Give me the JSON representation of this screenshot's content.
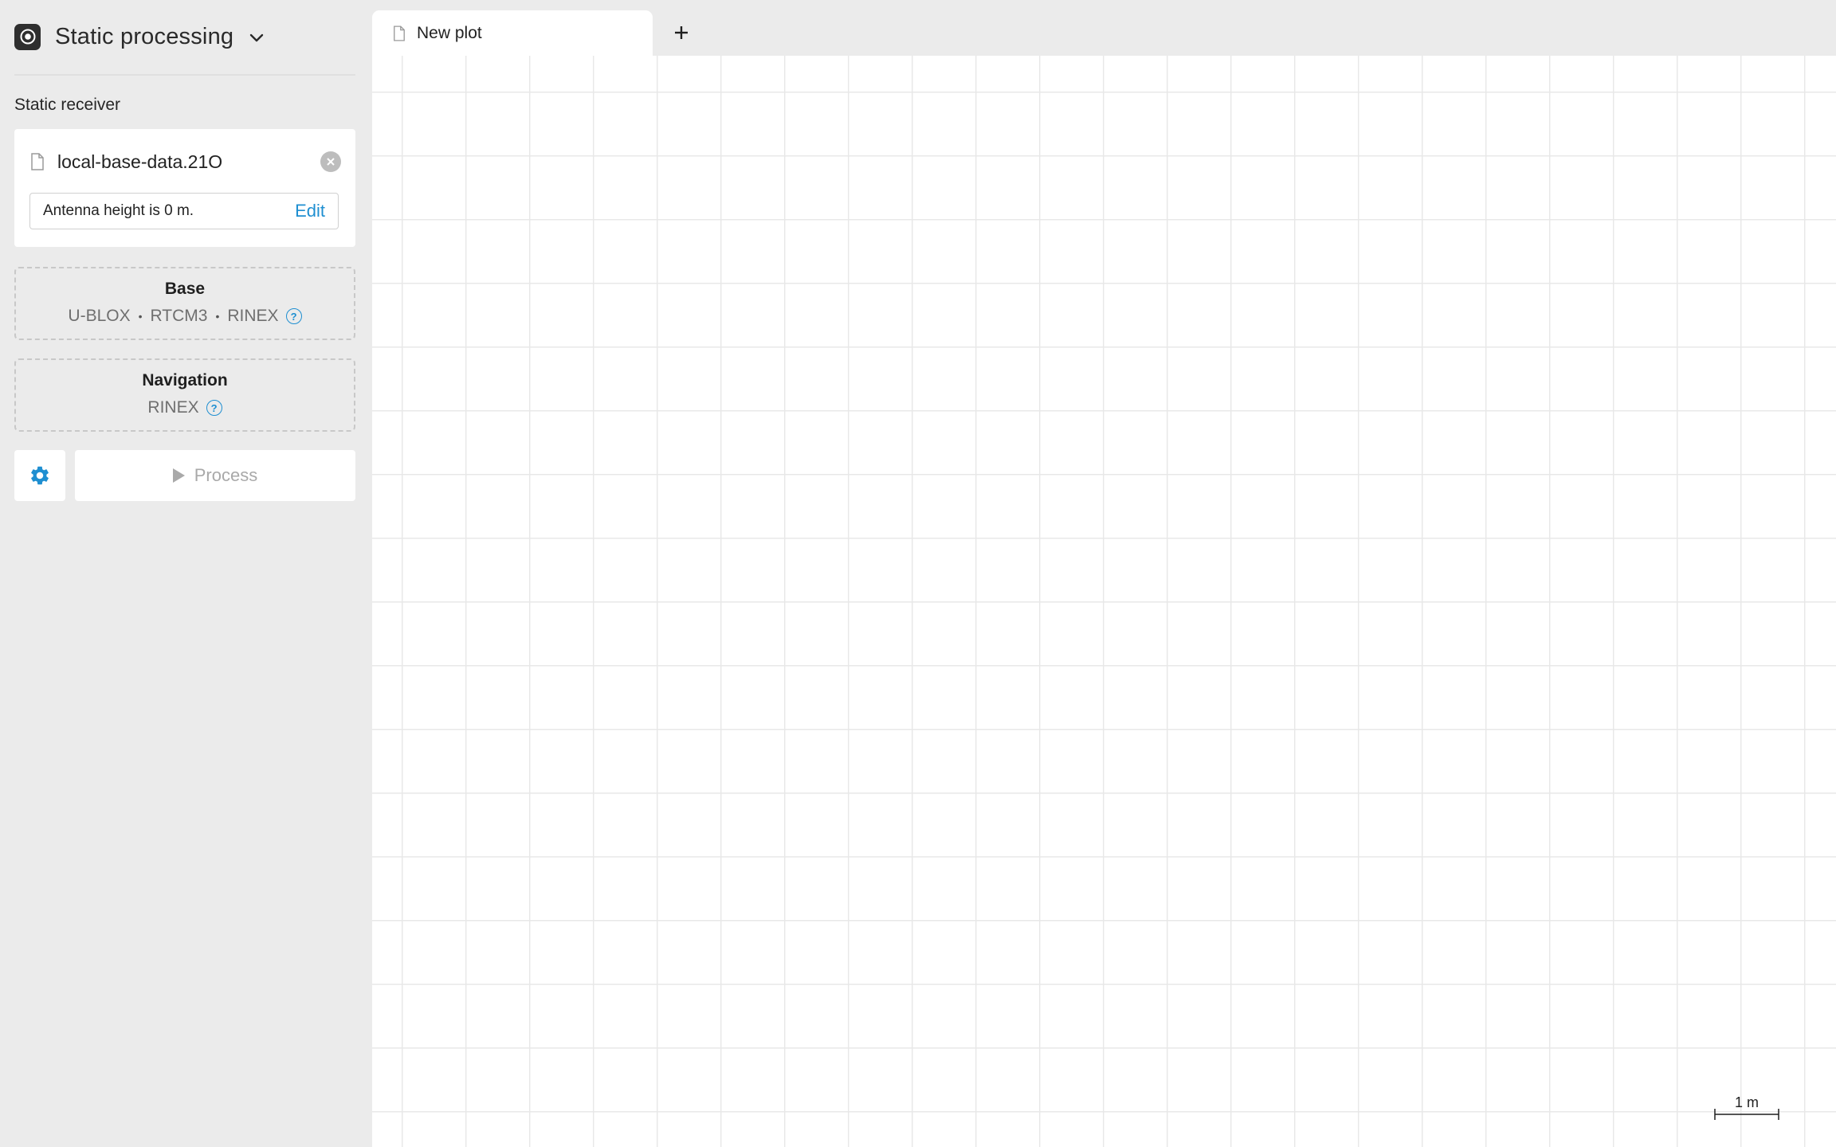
{
  "header": {
    "title": "Static processing",
    "logo_icon": "target-icon",
    "dropdown_icon": "chevron-down-icon"
  },
  "sidebar": {
    "section_label": "Static receiver",
    "file": {
      "name": "local-base-data.21O",
      "icon": "file-icon",
      "clear_icon": "close-circle-icon"
    },
    "antenna": {
      "text": "Antenna height is 0 m.",
      "edit_label": "Edit"
    },
    "base": {
      "title": "Base",
      "formats": [
        "U-BLOX",
        "RTCM3",
        "RINEX"
      ],
      "separator": "•"
    },
    "navigation": {
      "title": "Navigation",
      "formats": [
        "RINEX"
      ]
    },
    "process_label": "Process"
  },
  "tabs": [
    {
      "label": "New plot",
      "active": true
    }
  ],
  "plot": {
    "scale_label": "1 m"
  },
  "colors": {
    "accent": "#1f8fd1",
    "sidebar_bg": "#ebebeb",
    "panel_bg": "#ffffff",
    "disabled_text": "#a9a9a9"
  }
}
